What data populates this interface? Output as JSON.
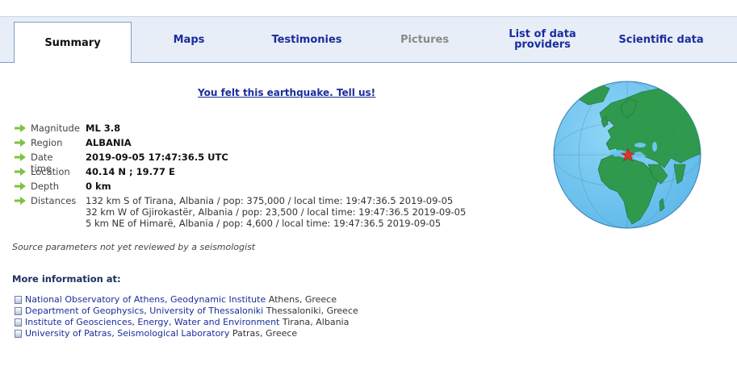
{
  "tabs": [
    {
      "label": "Summary",
      "active": true
    },
    {
      "label": "Maps"
    },
    {
      "label": "Testimonies"
    },
    {
      "label": "Pictures",
      "disabled": true
    },
    {
      "label": "List of data providers"
    },
    {
      "label": "Scientific data"
    }
  ],
  "felt_link": "You felt this earthquake. Tell us!",
  "params": {
    "magnitude": {
      "label": "Magnitude",
      "value": "ML 3.8"
    },
    "region": {
      "label": "Region",
      "value": "ALBANIA"
    },
    "datetime": {
      "label": "Date time",
      "value": "2019-09-05 17:47:36.5 UTC"
    },
    "location": {
      "label": "Location",
      "value": "40.14 N ; 19.77 E"
    },
    "depth": {
      "label": "Depth",
      "value": "0 km"
    },
    "distances": {
      "label": "Distances",
      "lines": [
        "132 km S of Tirana, Albania / pop: 375,000 / local time: 19:47:36.5 2019-09-05",
        "32 km W of Gjirokastër, Albania / pop: 23,500 / local time: 19:47:36.5 2019-09-05",
        "5 km NE of Himarë, Albania / pop: 4,600 / local time: 19:47:36.5 2019-09-05"
      ]
    }
  },
  "source_note": "Source parameters not yet reviewed by a seismologist",
  "more_info": {
    "heading": "More information at:",
    "links": [
      {
        "name": "National Observatory of Athens, Geodynamic Institute",
        "place": "Athens, Greece"
      },
      {
        "name": "Department of Geophysics, University of Thessaloniki",
        "place": "Thessaloniki, Greece"
      },
      {
        "name": "Institute of Geosciences, Energy, Water and Environment",
        "place": "Tirana, Albania"
      },
      {
        "name": "University of Patras, Seismological Laboratory",
        "place": "Patras, Greece"
      }
    ]
  },
  "colors": {
    "link": "#1a2d9c",
    "ocean": "#6ec5f0",
    "land": "#2f9a4e",
    "epicenter": "#e2322a",
    "arrow": "#7cc242"
  },
  "icons": {
    "param_bullet": "green-arrow-icon",
    "link_bullet": "page-bullet-icon",
    "epicenter": "red-star-icon"
  }
}
